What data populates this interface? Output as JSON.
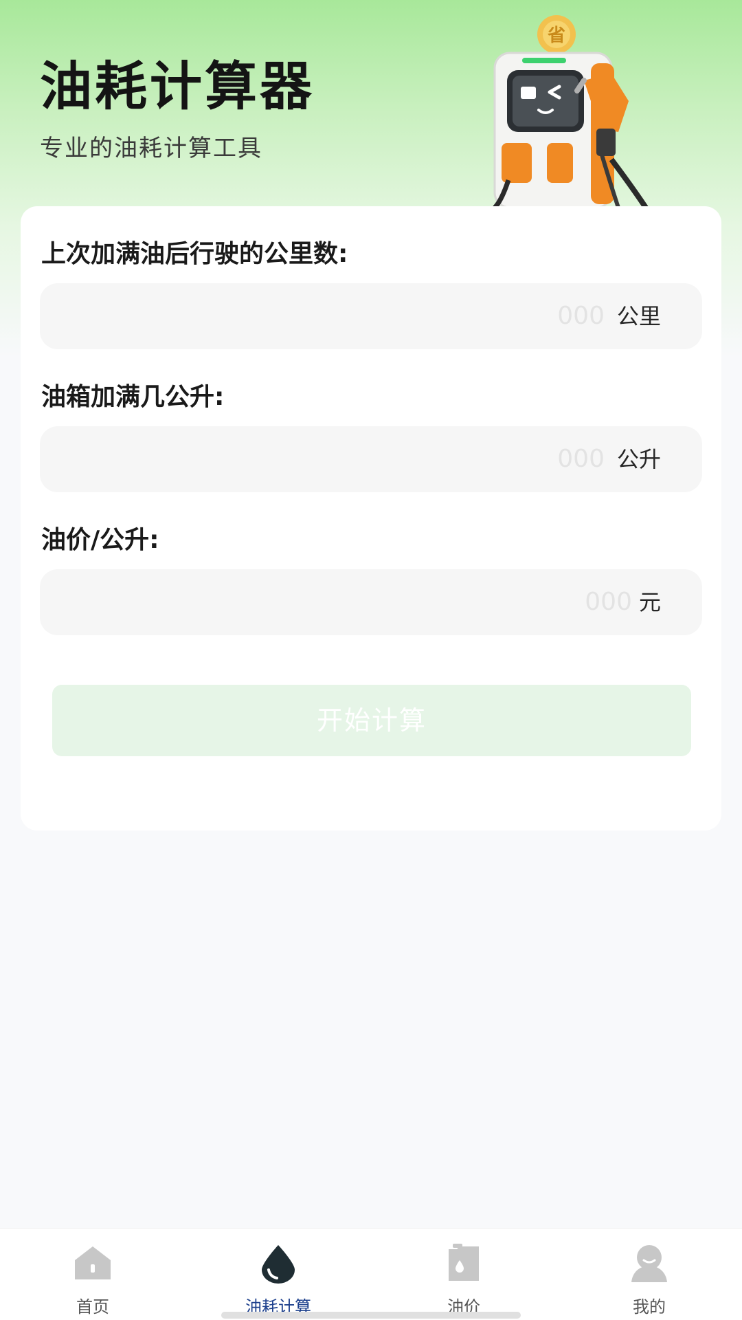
{
  "header": {
    "title": "油耗计算器",
    "subtitle": "专业的油耗计算工具",
    "mascot_badge": "省"
  },
  "form": {
    "fields": [
      {
        "label": "上次加满油后行驶的公里数:",
        "placeholder": "000",
        "unit": "公里"
      },
      {
        "label": "油箱加满几公升:",
        "placeholder": "000",
        "unit": "公升"
      },
      {
        "label": "油价/公升:",
        "placeholder": "000",
        "unit": "元"
      }
    ],
    "submit_label": "开始计算"
  },
  "tabbar": {
    "items": [
      {
        "label": "首页",
        "icon": "home-icon",
        "active": false
      },
      {
        "label": "油耗计算",
        "icon": "oil-drop-icon",
        "active": true
      },
      {
        "label": "油价",
        "icon": "fuel-can-icon",
        "active": false
      },
      {
        "label": "我的",
        "icon": "user-icon",
        "active": false
      }
    ]
  },
  "colors": {
    "accent": "#1c3f8c",
    "button_disabled": "#e6f5e7",
    "header_green": "#a8e89a",
    "icon_gray": "#c7c7c7",
    "icon_dark": "#1f2d33"
  }
}
